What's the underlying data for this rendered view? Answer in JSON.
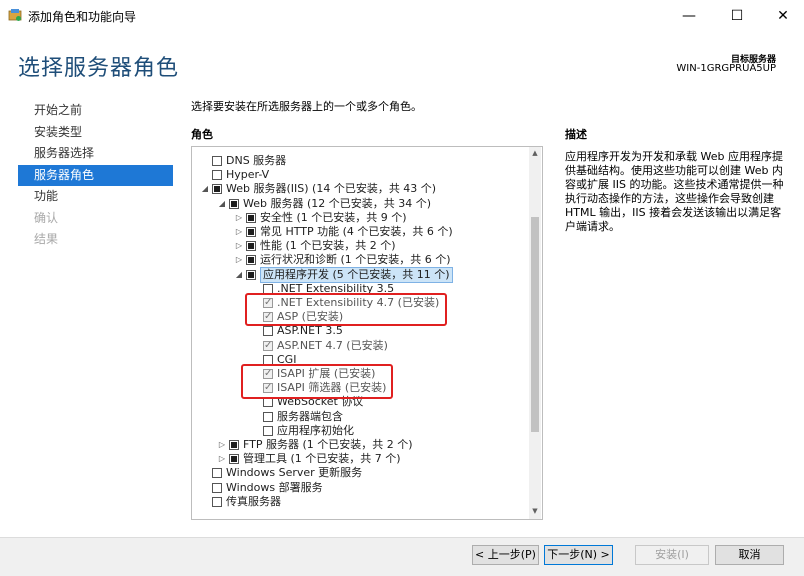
{
  "window": {
    "title": "添加角色和功能向导",
    "min_glyph": "—",
    "max_glyph": "☐",
    "close_glyph": "✕"
  },
  "page_title": "选择服务器角色",
  "target": {
    "label": "目标服务器",
    "name": "WIN-1GRGPRUA5UP"
  },
  "nav": {
    "items": [
      {
        "label": "开始之前",
        "state": "normal"
      },
      {
        "label": "安装类型",
        "state": "normal"
      },
      {
        "label": "服务器选择",
        "state": "normal"
      },
      {
        "label": "服务器角色",
        "state": "active"
      },
      {
        "label": "功能",
        "state": "normal"
      },
      {
        "label": "确认",
        "state": "disabled"
      },
      {
        "label": "结果",
        "state": "disabled"
      }
    ]
  },
  "instruction": "选择要安装在所选服务器上的一个或多个角色。",
  "roles_header": "角色",
  "description": {
    "header": "描述",
    "text": "应用程序开发为开发和承载 Web 应用程序提供基础结构。使用这些功能可以创建 Web 内容或扩展 IIS 的功能。这些技术通常提供一种执行动态操作的方法，这些操作会导致创建 HTML 输出，IIS 接着会发送该输出以满足客户端请求。"
  },
  "roles": [
    {
      "label": "DNS 服务器",
      "level": 0,
      "expander": "none",
      "check": "unchecked"
    },
    {
      "label": "Hyper-V",
      "level": 0,
      "expander": "none",
      "check": "unchecked"
    },
    {
      "label": "Web 服务器(IIS) (14 个已安装，共 43 个)",
      "level": 0,
      "expander": "expanded",
      "check": "partial"
    },
    {
      "label": "Web 服务器 (12 个已安装，共 34 个)",
      "level": 1,
      "expander": "expanded",
      "check": "partial"
    },
    {
      "label": "安全性 (1 个已安装，共 9 个)",
      "level": 2,
      "expander": "collapsed",
      "check": "partial"
    },
    {
      "label": "常见 HTTP 功能 (4 个已安装，共 6 个)",
      "level": 2,
      "expander": "collapsed",
      "check": "partial"
    },
    {
      "label": "性能 (1 个已安装，共 2 个)",
      "level": 2,
      "expander": "collapsed",
      "check": "partial"
    },
    {
      "label": "运行状况和诊断 (1 个已安装，共 6 个)",
      "level": 2,
      "expander": "collapsed",
      "check": "partial"
    },
    {
      "label": "应用程序开发 (5 个已安装，共 11 个)",
      "level": 2,
      "expander": "expanded",
      "check": "partial",
      "selected": true
    },
    {
      "label": ".NET Extensibility 3.5",
      "level": 3,
      "expander": "none",
      "check": "unchecked"
    },
    {
      "label": ".NET Extensibility 4.7 (已安装)",
      "level": 3,
      "expander": "none",
      "check": "checked"
    },
    {
      "label": "ASP (已安装)",
      "level": 3,
      "expander": "none",
      "check": "checked"
    },
    {
      "label": "ASP.NET 3.5",
      "level": 3,
      "expander": "none",
      "check": "unchecked"
    },
    {
      "label": "ASP.NET 4.7 (已安装)",
      "level": 3,
      "expander": "none",
      "check": "checked"
    },
    {
      "label": "CGI",
      "level": 3,
      "expander": "none",
      "check": "unchecked"
    },
    {
      "label": "ISAPI 扩展 (已安装)",
      "level": 3,
      "expander": "none",
      "check": "checked"
    },
    {
      "label": "ISAPI 筛选器 (已安装)",
      "level": 3,
      "expander": "none",
      "check": "checked"
    },
    {
      "label": "WebSocket 协议",
      "level": 3,
      "expander": "none",
      "check": "unchecked"
    },
    {
      "label": "服务器端包含",
      "level": 3,
      "expander": "none",
      "check": "unchecked"
    },
    {
      "label": "应用程序初始化",
      "level": 3,
      "expander": "none",
      "check": "unchecked"
    },
    {
      "label": "FTP 服务器 (1 个已安装，共 2 个)",
      "level": 1,
      "expander": "collapsed",
      "check": "partial"
    },
    {
      "label": "管理工具 (1 个已安装，共 7 个)",
      "level": 1,
      "expander": "collapsed",
      "check": "partial"
    },
    {
      "label": "Windows Server 更新服务",
      "level": 0,
      "expander": "none",
      "check": "unchecked"
    },
    {
      "label": "Windows 部署服务",
      "level": 0,
      "expander": "none",
      "check": "unchecked"
    },
    {
      "label": "传真服务器",
      "level": 0,
      "expander": "none",
      "check": "unchecked"
    }
  ],
  "buttons": {
    "prev": "< 上一步(P)",
    "next": "下一步(N) >",
    "install": "安装(I)",
    "cancel": "取消"
  },
  "colors": {
    "accent": "#1e78d6",
    "title": "#1f4e79",
    "highlight_box": "#e02020"
  }
}
